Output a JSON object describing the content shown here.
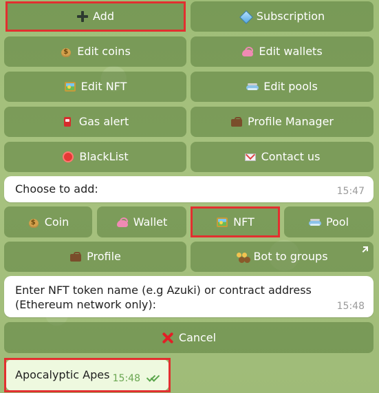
{
  "top_menu": {
    "add": "Add",
    "subscription": "Subscription",
    "edit_coins": "Edit coins",
    "edit_wallets": "Edit wallets",
    "edit_nft": "Edit NFT",
    "edit_pools": "Edit pools",
    "gas_alert": "Gas alert",
    "profile_manager": "Profile Manager",
    "blacklist": "BlackList",
    "contact_us": "Contact us"
  },
  "messages": {
    "choose_to_add": {
      "text": "Choose to add:",
      "time": "15:47"
    },
    "nft_prompt": {
      "text": "Enter NFT token name (e.g Azuki) or contract address (Ethereum network only):",
      "time": "15:48"
    },
    "user_reply": {
      "text": "Apocalyptic Apes",
      "time": "15:48"
    }
  },
  "add_menu": {
    "coin": "Coin",
    "wallet": "Wallet",
    "nft": "NFT",
    "pool": "Pool",
    "profile": "Profile",
    "bot_to_groups": "Bot to groups",
    "cancel": "Cancel"
  },
  "icons": {
    "add": "plus-icon",
    "subscription": "diamond-icon",
    "coin": "money-bag-icon",
    "wallet": "purse-icon",
    "nft": "framed-picture-icon",
    "pool": "pool-icon",
    "gas_alert": "fuel-pump-icon",
    "profile": "briefcase-icon",
    "blacklist": "stop-sign-icon",
    "contact": "envelope-icon",
    "bot_to_groups": "group-icon",
    "cancel": "close-icon",
    "expand": "expand-arrow-icon",
    "status": "double-check-icon"
  },
  "colors": {
    "button_bg": "#4a6e2e",
    "highlight": "#e22f2f",
    "outgoing_bubble": "#eef9df",
    "check": "#5aa54b"
  }
}
